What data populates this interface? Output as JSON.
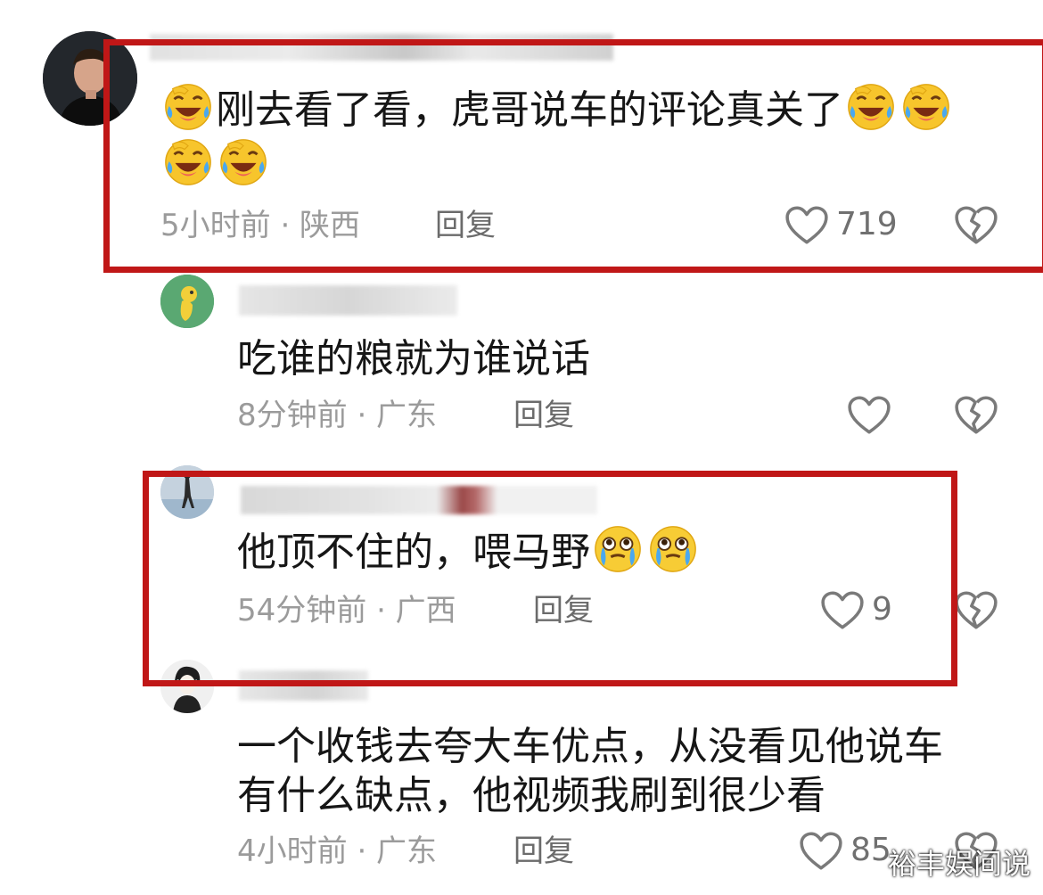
{
  "comments": [
    {
      "text": "刚去看了看，虎哥说车的评论真关了",
      "emoji": [
        "laugh-cry-emoji",
        "laugh-cry-emoji",
        "laugh-cry-emoji",
        "laugh-cry-emoji",
        "laugh-cry-emoji"
      ],
      "meta": "5小时前 · 陕西",
      "reply": "回复",
      "likes": "719"
    },
    {
      "text": "吃谁的粮就为谁说话",
      "meta": "8分钟前 · 广东",
      "reply": "回复",
      "likes": ""
    },
    {
      "text": "他顶不住的，喂马野",
      "emoji": [
        "pleading-tears-emoji",
        "pleading-tears-emoji"
      ],
      "meta": "54分钟前 · 广西",
      "reply": "回复",
      "likes": "9"
    },
    {
      "text_line1": "一个收钱去夸大车优点，从没看见他说车",
      "text_line2": "有什么缺点，他视频我刷到很少看",
      "meta": "4小时前 · 广东",
      "reply": "回复",
      "likes": "85"
    }
  ],
  "watermark": "裕丰娱间说",
  "colors": {
    "highlight_border": "#c01717",
    "meta_text": "#9b9b9b"
  }
}
